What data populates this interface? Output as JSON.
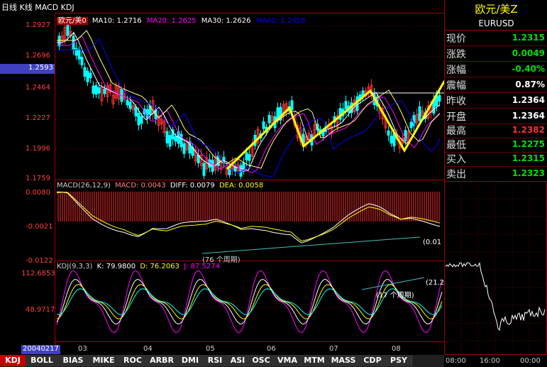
{
  "header": {
    "title": "日线 K线 MACD KDJ"
  },
  "price_panel": {
    "legend": {
      "symbol": "欧元/美0",
      "ma10": "MA10: 1.2716",
      "ma20": "MA20: 1.2625",
      "ma30": "MA30: 1.2626",
      "ma60": "MA60: 1.2458"
    },
    "y_labels": [
      "1.2927",
      "1.2696",
      "1.2593",
      "1.2464",
      "1.2227",
      "1.1996",
      "1.1759"
    ]
  },
  "macd_panel": {
    "legend": {
      "name": "MACD(26,12,9)",
      "macd": "MACD: 0.0043",
      "diff": "DIFF: 0.0079",
      "dea": "DEA: 0.0058"
    },
    "y_labels": [
      "0.0080",
      "-0.0021",
      "-0.0122"
    ],
    "annotations": [
      "(76 个周期)",
      "(0.01"
    ]
  },
  "kdj_panel": {
    "legend": {
      "name": "KDJ(9,3,3)",
      "k": "K: 79.9800",
      "d": "D: 76.2063",
      "j": "J: 87.5274"
    },
    "y_labels": [
      "112.6853",
      "48.9717"
    ],
    "annotations": [
      "(17 个周期)",
      "(21.2"
    ]
  },
  "x_axis": {
    "date": "20040217",
    "months": [
      "03",
      "04",
      "05",
      "06",
      "07",
      "08"
    ]
  },
  "quote": {
    "title": "欧元/美Z",
    "code": "EURUSD",
    "rows": [
      {
        "label": "现价",
        "value": "1.2315",
        "color": "#00e000"
      },
      {
        "label": "涨跌",
        "value": "0.0049",
        "color": "#00e000"
      },
      {
        "label": "涨幅",
        "value": "-0.40%",
        "color": "#00e000"
      },
      {
        "label": "震幅",
        "value": "0.87%",
        "color": "#ffffff"
      },
      {
        "label": "昨收",
        "value": "1.2364",
        "color": "#ffffff"
      },
      {
        "label": "开盘",
        "value": "1.2364",
        "color": "#ffffff"
      },
      {
        "label": "最高",
        "value": "1.2382",
        "color": "#ff3030"
      },
      {
        "label": "最低",
        "value": "1.2275",
        "color": "#00e000"
      },
      {
        "label": "买入",
        "value": "1.2315",
        "color": "#00e000"
      },
      {
        "label": "卖出",
        "value": "1.2323",
        "color": "#00e000"
      }
    ]
  },
  "intraday": {
    "times": [
      "08:00",
      "16:00",
      "00:00"
    ]
  },
  "tabs": [
    "KDJ",
    "BOLL",
    "BIAS",
    "MIKE",
    "ROC",
    "ARBR",
    "DMI",
    "RSI",
    "ASI",
    "OSC",
    "VMA",
    "MTM",
    "MASS",
    "CDP",
    "PSY"
  ],
  "colors": {
    "up": "#ff3030",
    "down": "#00ffff",
    "frame": "#a00000",
    "accent": "#ffff00"
  }
}
